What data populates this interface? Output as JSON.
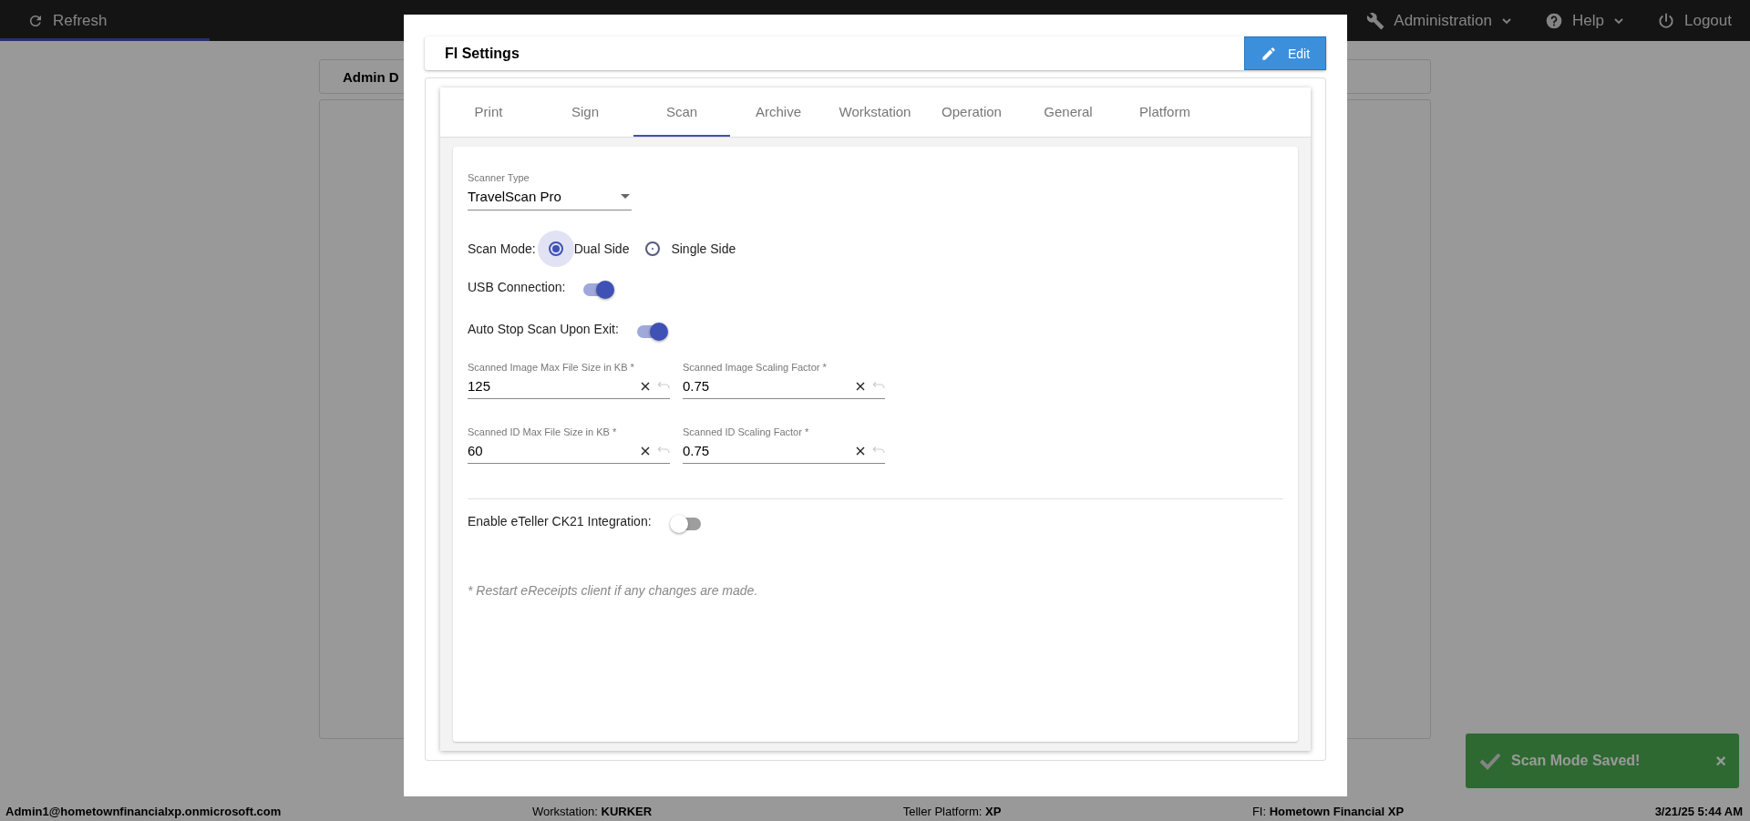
{
  "top_bar": {
    "refresh": "Refresh",
    "progress": {
      "level": 0.12
    },
    "menus": [
      {
        "label": "Administration"
      },
      {
        "label": "Help"
      }
    ],
    "logout": "Logout"
  },
  "page_card": {
    "title": "Admin D"
  },
  "status_bar": [
    "Admin1@hometownfinancialxp.onmicrosoft.com",
    "Workstation: **KURKER**",
    "Teller Platform: **XP**",
    "FI: **Hometown Financial XP**",
    "3/21/25 5:44 AM"
  ],
  "toast": {
    "message": "Scan Mode Saved!",
    "close": "×"
  },
  "modal": {
    "title": "FI Settings",
    "edit_button": "Edit",
    "tabs": [
      {
        "label": "Print",
        "selected": false
      },
      {
        "label": "Sign",
        "selected": false
      },
      {
        "label": "Scan",
        "selected": true
      },
      {
        "label": "Archive",
        "selected": false
      },
      {
        "label": "Workstation",
        "selected": false
      },
      {
        "label": "Operation",
        "selected": false
      },
      {
        "label": "General",
        "selected": false
      },
      {
        "label": "Platform",
        "selected": false
      }
    ],
    "scanner_type": {
      "label": "Scanner Type",
      "value": "TravelScan Pro"
    },
    "scan_mode": {
      "label": "Scan Mode:",
      "options": [
        {
          "label": "Dual Side",
          "selected": true
        },
        {
          "label": "Single Side",
          "selected": false
        }
      ]
    },
    "toggles": [
      {
        "label": "USB Connection:",
        "on": true
      },
      {
        "label": "Auto Stop Scan Upon Exit:",
        "on": true
      }
    ],
    "fields": [
      {
        "label": "Scanned Image Max File Size in KB *",
        "value": "125"
      },
      {
        "label": "Scanned Image Scaling Factor *",
        "value": "0.75"
      },
      {
        "label": "Scanned ID Max File Size in KB *",
        "value": "60"
      },
      {
        "label": "Scanned ID Scaling Factor *",
        "value": "0.75"
      }
    ],
    "integration_toggle": {
      "label": "Enable eTeller CK21 Integration:",
      "on": false
    },
    "note": "* Restart eReceipts client if any changes are made."
  }
}
